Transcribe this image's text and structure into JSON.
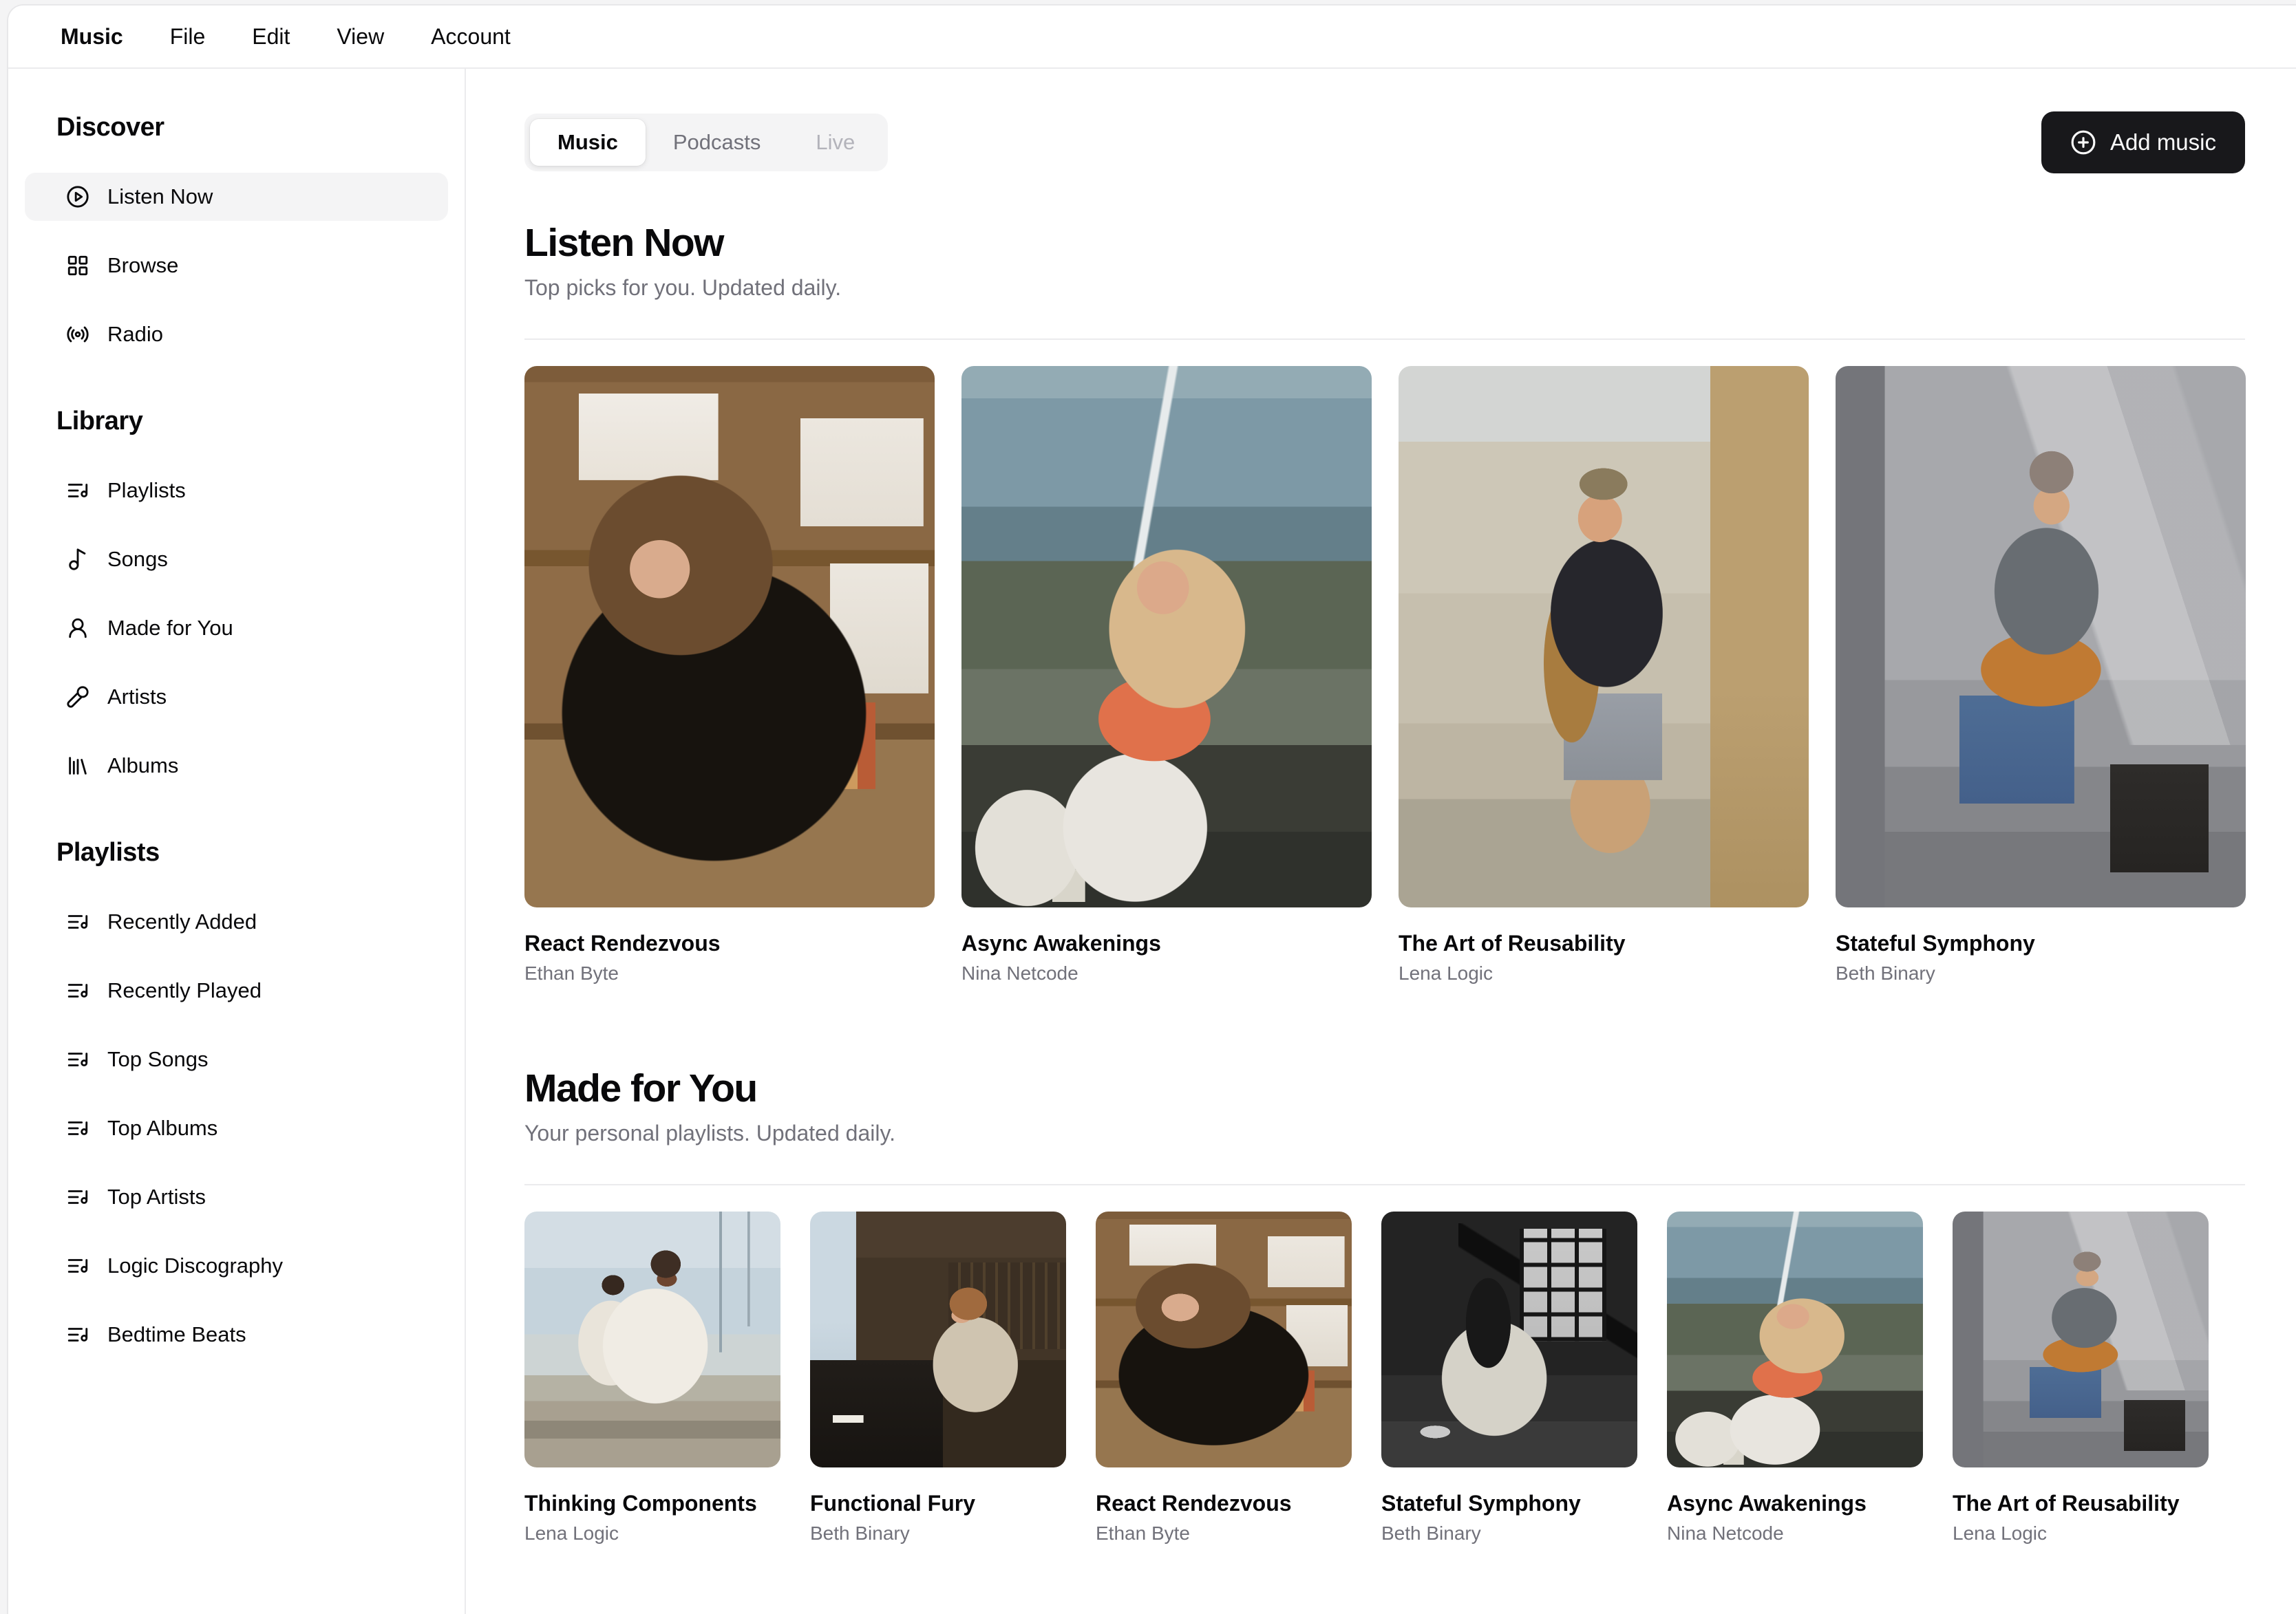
{
  "menubar": {
    "items": [
      "Music",
      "File",
      "Edit",
      "View",
      "Account"
    ]
  },
  "sidebar": {
    "sections": [
      {
        "title": "Discover",
        "items": [
          {
            "label": "Listen Now",
            "icon": "circle-play",
            "active": true
          },
          {
            "label": "Browse",
            "icon": "layout-grid",
            "active": false
          },
          {
            "label": "Radio",
            "icon": "radio",
            "active": false
          }
        ]
      },
      {
        "title": "Library",
        "items": [
          {
            "label": "Playlists",
            "icon": "list-music",
            "active": false
          },
          {
            "label": "Songs",
            "icon": "music-note",
            "active": false
          },
          {
            "label": "Made for You",
            "icon": "user-round",
            "active": false
          },
          {
            "label": "Artists",
            "icon": "microphone",
            "active": false
          },
          {
            "label": "Albums",
            "icon": "library",
            "active": false
          }
        ]
      },
      {
        "title": "Playlists",
        "items": [
          {
            "label": "Recently Added",
            "icon": "list-music",
            "active": false
          },
          {
            "label": "Recently Played",
            "icon": "list-music",
            "active": false
          },
          {
            "label": "Top Songs",
            "icon": "list-music",
            "active": false
          },
          {
            "label": "Top Albums",
            "icon": "list-music",
            "active": false
          },
          {
            "label": "Top Artists",
            "icon": "list-music",
            "active": false
          },
          {
            "label": "Logic Discography",
            "icon": "list-music",
            "active": false
          },
          {
            "label": "Bedtime Beats",
            "icon": "list-music",
            "active": false
          }
        ]
      }
    ]
  },
  "content": {
    "tabs": [
      {
        "label": "Music",
        "state": "active"
      },
      {
        "label": "Podcasts",
        "state": "default"
      },
      {
        "label": "Live",
        "state": "disabled"
      }
    ],
    "add_button": {
      "label": "Add music",
      "icon": "circle-plus"
    },
    "listen_now": {
      "title": "Listen Now",
      "subtitle": "Top picks for you. Updated daily.",
      "albums": [
        {
          "title": "React Rendezvous",
          "artist": "Ethan Byte",
          "art": "headphones-study"
        },
        {
          "title": "Async Awakenings",
          "artist": "Nina Netcode",
          "art": "window-reflection"
        },
        {
          "title": "The Art of Reusability",
          "artist": "Lena Logic",
          "art": "saxophone-street"
        },
        {
          "title": "Stateful Symphony",
          "artist": "Beth Binary",
          "art": "guitar-steps"
        }
      ]
    },
    "made_for_you": {
      "title": "Made for You",
      "subtitle": "Your personal playlists. Updated daily.",
      "albums": [
        {
          "title": "Thinking Components",
          "artist": "Lena Logic",
          "art": "marina-white"
        },
        {
          "title": "Functional Fury",
          "artist": "Beth Binary",
          "art": "piano-room"
        },
        {
          "title": "React Rendezvous",
          "artist": "Ethan Byte",
          "art": "headphones-study"
        },
        {
          "title": "Stateful Symphony",
          "artist": "Beth Binary",
          "art": "trumpet-bw"
        },
        {
          "title": "Async Awakenings",
          "artist": "Nina Netcode",
          "art": "window-reflection"
        },
        {
          "title": "The Art of Reusability",
          "artist": "Lena Logic",
          "art": "guitar-steps"
        }
      ]
    }
  },
  "colors": {
    "accent": "#18181b",
    "text": "#09090b",
    "muted_text": "#71717a",
    "border": "#ebebed",
    "pill_bg": "#f4f4f5",
    "page_bg": "#f4f4f5"
  }
}
